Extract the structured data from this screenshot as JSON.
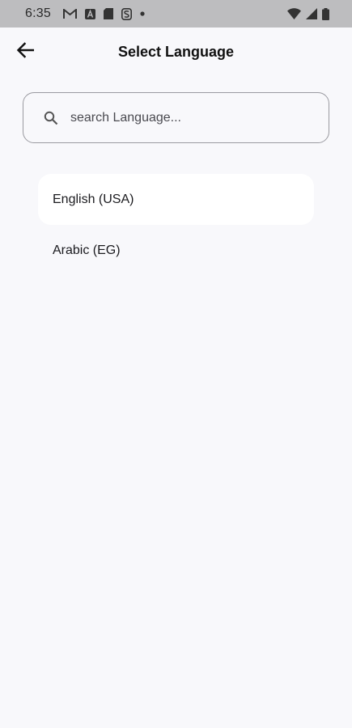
{
  "status_bar": {
    "time": "6:35",
    "left_icons": [
      "gmail-icon",
      "a-app-icon",
      "sd-card-icon",
      "s-app-icon",
      "dot-icon"
    ],
    "right_icons": [
      "wifi-icon",
      "signal-icon",
      "battery-icon"
    ]
  },
  "app_bar": {
    "title": "Select Language",
    "back_icon": "arrow-left-icon"
  },
  "search": {
    "placeholder": "search Language...",
    "value": ""
  },
  "languages": [
    {
      "label": "English (USA)",
      "selected": true
    },
    {
      "label": "Arabic (EG)",
      "selected": false
    }
  ],
  "colors": {
    "background": "#f8f8fb",
    "status_bar": "#bdbdbf",
    "selected_item": "#ffffff",
    "search_border": "#9a9aa0"
  }
}
